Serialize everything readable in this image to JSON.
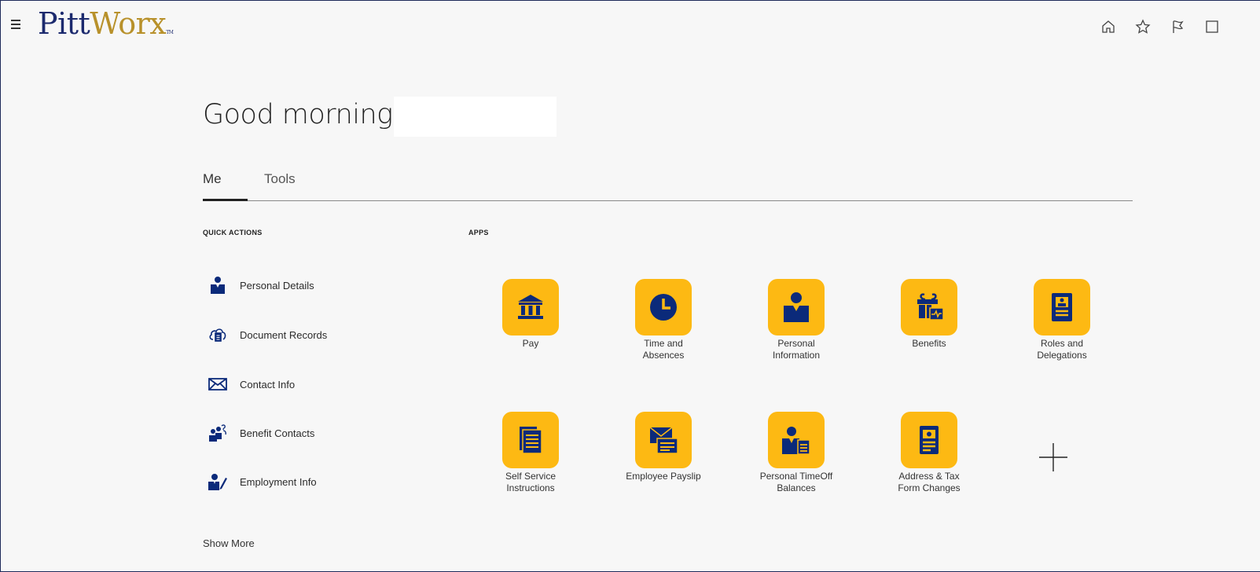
{
  "header": {
    "logo_part1": "Pitt",
    "logo_part2": "Worx",
    "logo_tm": "TM"
  },
  "greeting": "Good morning,",
  "tabs": [
    {
      "label": "Me",
      "active": true
    },
    {
      "label": "Tools",
      "active": false
    }
  ],
  "quick_actions": {
    "label": "QUICK ACTIONS",
    "items": [
      {
        "label": "Personal Details",
        "icon": "person-icon"
      },
      {
        "label": "Document Records",
        "icon": "cloud-document-icon"
      },
      {
        "label": "Contact Info",
        "icon": "envelope-icon"
      },
      {
        "label": "Benefit Contacts",
        "icon": "people-question-icon"
      },
      {
        "label": "Employment Info",
        "icon": "person-pen-icon"
      }
    ],
    "show_more": "Show More"
  },
  "apps": {
    "label": "APPS",
    "items": [
      {
        "label": "Pay",
        "icon": "bank-icon"
      },
      {
        "label": "Time and\nAbsences",
        "icon": "clock-icon"
      },
      {
        "label": "Personal\nInformation",
        "icon": "person-icon"
      },
      {
        "label": "Benefits",
        "icon": "gift-icon"
      },
      {
        "label": "Roles and\nDelegations",
        "icon": "badge-icon"
      },
      {
        "label": "Self Service\nInstructions",
        "icon": "documents-icon"
      },
      {
        "label": "Employee Payslip",
        "icon": "mail-payslip-icon"
      },
      {
        "label": "Personal TimeOff\nBalances",
        "icon": "person-document-icon"
      },
      {
        "label": "Address & Tax\nForm Changes",
        "icon": "form-icon"
      }
    ]
  },
  "colors": {
    "tile": "#fdb913",
    "icon_navy": "#0b2a7a",
    "logo_navy": "#1c2a6e",
    "logo_gold": "#b8912b"
  }
}
